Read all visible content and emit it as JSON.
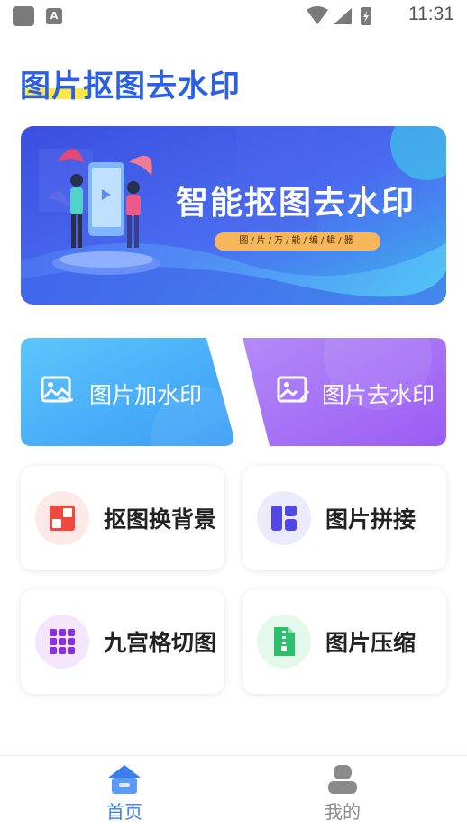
{
  "status_bar": {
    "time": "11:31",
    "app_icon_letter": "A"
  },
  "app_title": "图片抠图去水印",
  "banner": {
    "title": "智能抠图去水印",
    "tagline": "图/片/万/能/编/辑/器"
  },
  "features": [
    {
      "label": "图片加水印",
      "icon": "image-watermark-add-icon"
    },
    {
      "label": "图片去水印",
      "icon": "image-watermark-remove-icon"
    }
  ],
  "tools": [
    {
      "label": "抠图换背景",
      "icon": "cutout-icon",
      "color": "#f0473f",
      "bg": "#fde9e8"
    },
    {
      "label": "图片拼接",
      "icon": "collage-icon",
      "color": "#5146e6",
      "bg": "#eceafd"
    },
    {
      "label": "九宫格切图",
      "icon": "grid-nine-icon",
      "color": "#8a2fe0",
      "bg": "#f3e6fd"
    },
    {
      "label": "图片压缩",
      "icon": "zip-file-icon",
      "color": "#2bc06b",
      "bg": "#e5f8ec"
    }
  ],
  "nav": {
    "home_label": "首页",
    "mine_label": "我的",
    "active_color": "#3a7ef0",
    "inactive_color": "#8a8a8a"
  }
}
